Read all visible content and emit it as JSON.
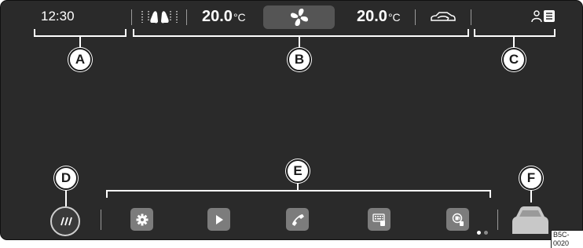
{
  "status_bar": {
    "clock": "12:30",
    "left_temperature": {
      "value": "20.0",
      "unit": "°C"
    },
    "right_temperature": {
      "value": "20.0",
      "unit": "°C"
    }
  },
  "callouts": {
    "a": "A",
    "b": "B",
    "c": "C",
    "d": "D",
    "e": "E",
    "f": "F"
  },
  "app_bar": {
    "icons": [
      "settings-icon",
      "play-icon",
      "phone-icon",
      "keyboard-phone-icon",
      "fuel-icon"
    ],
    "page_indicator": {
      "pages": 2,
      "active": 1
    }
  },
  "image_code": "B5C-0020",
  "colors": {
    "screen_background": "#2a2a2a",
    "button_grey": "#7c7c7c",
    "fan_button": "#555555",
    "callout_fill": "#ffffff"
  }
}
